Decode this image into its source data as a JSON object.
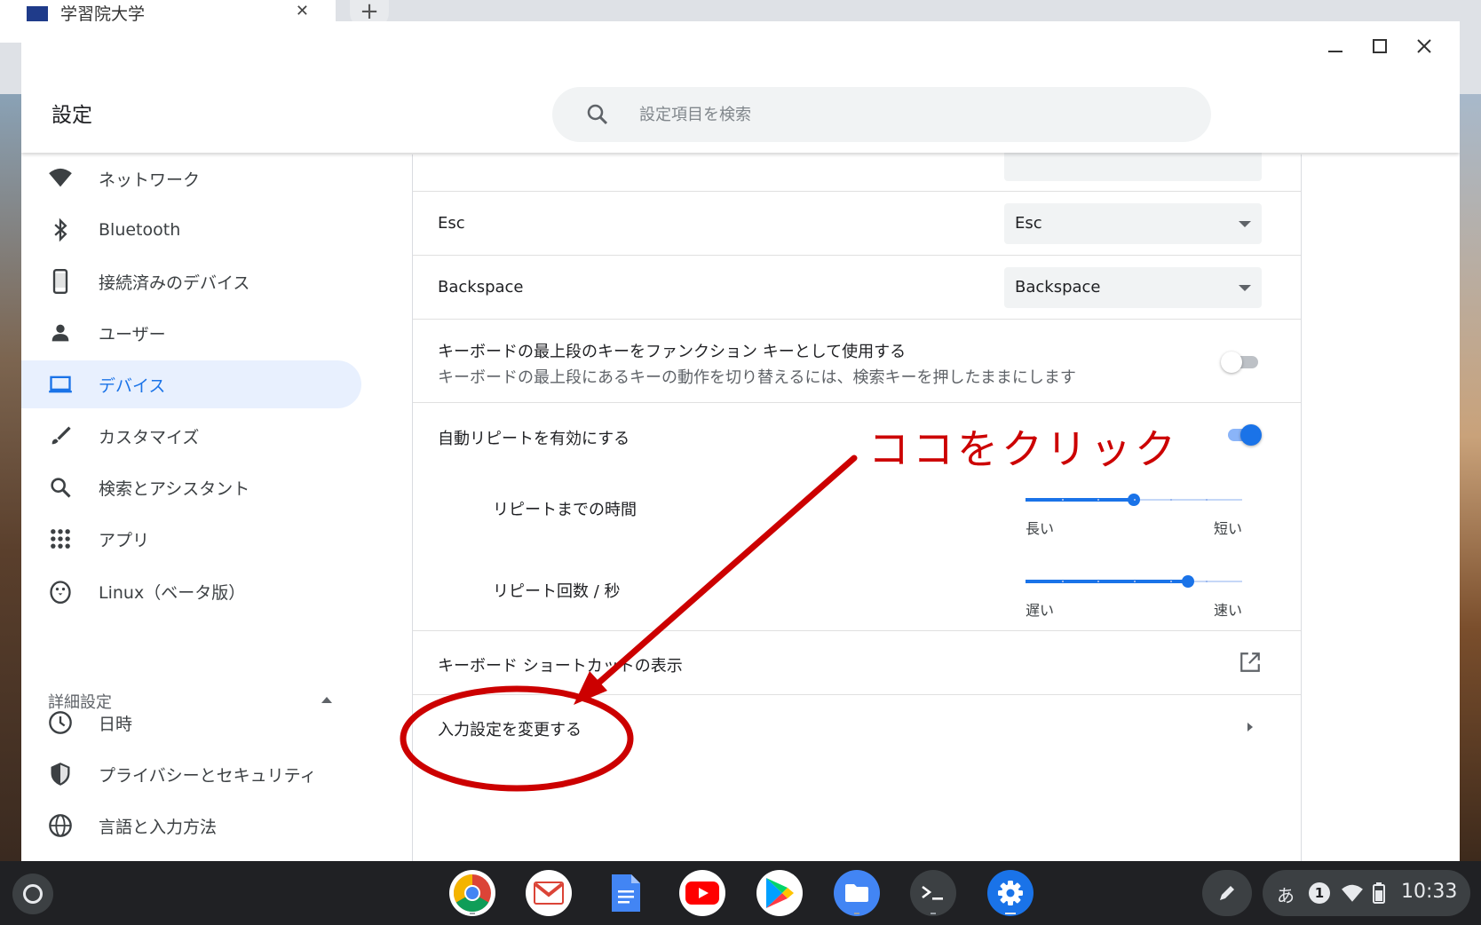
{
  "browser": {
    "tab_title": "学習院大学"
  },
  "app": {
    "title": "設定"
  },
  "search": {
    "placeholder": "設定項目を検索"
  },
  "sidebar": {
    "items": [
      {
        "label": "ネットワーク",
        "icon": "wifi-icon"
      },
      {
        "label": "Bluetooth",
        "icon": "bluetooth-icon"
      },
      {
        "label": "接続済みのデバイス",
        "icon": "phone-icon"
      },
      {
        "label": "ユーザー",
        "icon": "person-icon"
      },
      {
        "label": "デバイス",
        "icon": "laptop-icon",
        "active": true
      },
      {
        "label": "カスタマイズ",
        "icon": "brush-icon"
      },
      {
        "label": "検索とアシスタント",
        "icon": "search-icon"
      },
      {
        "label": "アプリ",
        "icon": "apps-grid-icon"
      },
      {
        "label": "Linux（ベータ版）",
        "icon": "penguin-icon"
      }
    ],
    "advanced_label": "詳細設定",
    "advanced_items": [
      {
        "label": "日時",
        "icon": "clock-icon"
      },
      {
        "label": "プライバシーとセキュリティ",
        "icon": "shield-icon"
      },
      {
        "label": "言語と入力方法",
        "icon": "globe-icon"
      }
    ]
  },
  "main": {
    "esc": {
      "label": "Esc",
      "value": "Esc"
    },
    "backspace": {
      "label": "Backspace",
      "value": "Backspace"
    },
    "function_keys": {
      "label": "キーボードの最上段のキーをファンクション キーとして使用する",
      "sublabel": "キーボードの最上段にあるキーの動作を切り替えるには、検索キーを押したままにします",
      "enabled": false
    },
    "auto_repeat": {
      "label": "自動リピートを有効にする",
      "enabled": true
    },
    "repeat_delay": {
      "label": "リピートまでの時間",
      "min_label": "長い",
      "max_label": "短い",
      "value": 0.5
    },
    "repeat_rate": {
      "label": "リピート回数 / 秒",
      "min_label": "遅い",
      "max_label": "速い",
      "value": 0.75
    },
    "shortcuts": {
      "label": "キーボード ショートカットの表示"
    },
    "input_settings": {
      "label": "入力設定を変更する"
    }
  },
  "annotation": {
    "text": "ココをクリック",
    "color": "#cc0000"
  },
  "shelf": {
    "apps": [
      "chrome-icon",
      "gmail-icon",
      "docs-icon",
      "youtube-icon",
      "play-store-icon",
      "files-icon",
      "terminal-icon",
      "settings-icon"
    ],
    "ime": "あ",
    "notifications": "1",
    "time": "10:33"
  },
  "colors": {
    "accent": "#1a73e8",
    "active_bg": "#e8f0fe",
    "annotation": "#cc0000"
  }
}
